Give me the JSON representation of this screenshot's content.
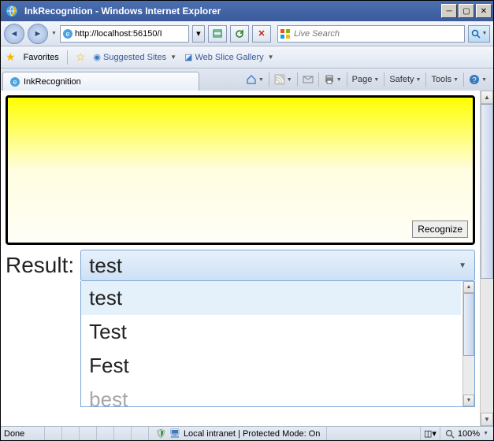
{
  "window": {
    "title": "InkRecognition - Windows Internet Explorer"
  },
  "nav": {
    "url": "http://localhost:56150/I",
    "search_placeholder": "Live Search"
  },
  "favbar": {
    "favorites_label": "Favorites",
    "suggested_label": "Suggested Sites",
    "webslice_label": "Web Slice Gallery"
  },
  "tab": {
    "title": "InkRecognition"
  },
  "cmdbar": {
    "page": "Page",
    "safety": "Safety",
    "tools": "Tools"
  },
  "content": {
    "recognize_label": "Recognize",
    "result_label": "Result:",
    "selected": "test",
    "options": [
      "test",
      "Test",
      "Fest",
      "best"
    ]
  },
  "status": {
    "done": "Done",
    "zone": "Local intranet | Protected Mode: On",
    "zoom": "100%"
  }
}
